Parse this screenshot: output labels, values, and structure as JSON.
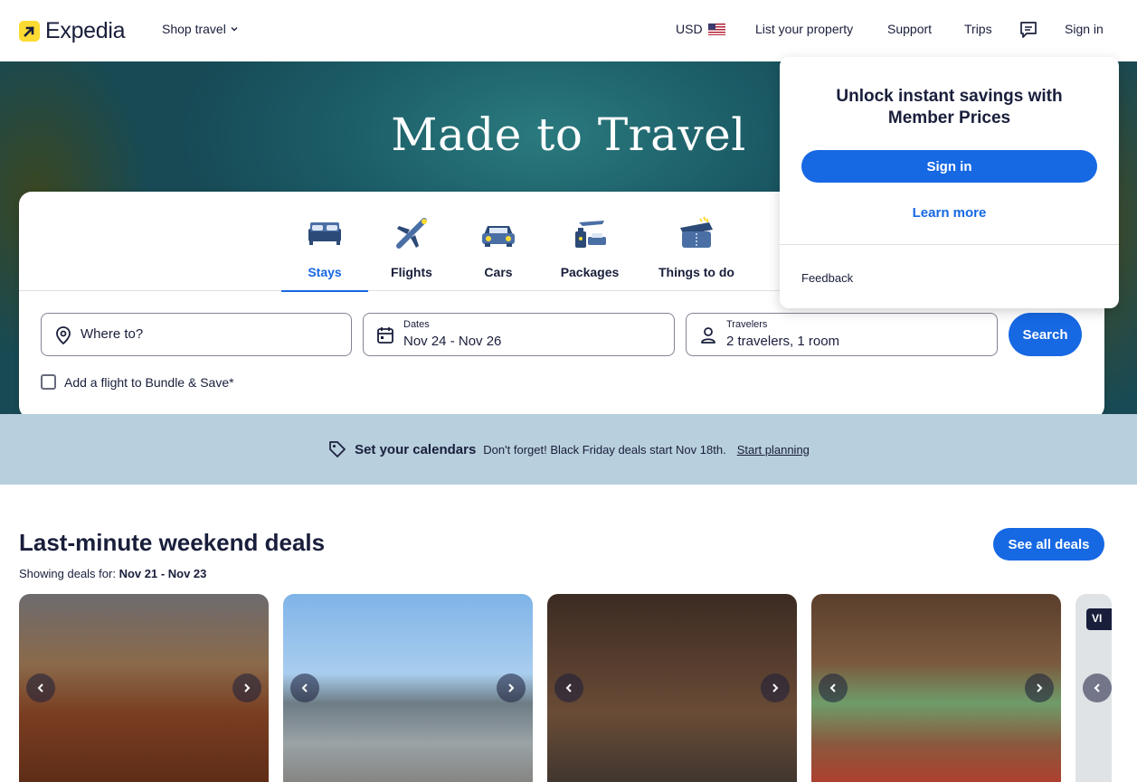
{
  "header": {
    "brand": "Expedia",
    "shop_travel": "Shop travel",
    "currency": "USD",
    "list_property": "List your property",
    "support": "Support",
    "trips": "Trips",
    "sign_in": "Sign in"
  },
  "hero": {
    "title": "Made to Travel"
  },
  "tabs": [
    {
      "label": "Stays",
      "icon": "bed-icon",
      "active": true
    },
    {
      "label": "Flights",
      "icon": "airplane-icon"
    },
    {
      "label": "Cars",
      "icon": "car-icon"
    },
    {
      "label": "Packages",
      "icon": "package-icon"
    },
    {
      "label": "Things to do",
      "icon": "ticket-icon"
    }
  ],
  "search": {
    "where_placeholder": "Where to?",
    "dates_label": "Dates",
    "dates_value": "Nov 24 - Nov 26",
    "travelers_label": "Travelers",
    "travelers_value": "2 travelers, 1 room",
    "button": "Search",
    "bundle_label": "Add a flight to Bundle & Save*"
  },
  "popup": {
    "title": "Unlock instant savings with Member Prices",
    "sign_in": "Sign in",
    "learn_more": "Learn more",
    "feedback": "Feedback"
  },
  "banner": {
    "title": "Set your calendars",
    "text": "Don't forget! Black Friday deals start Nov 18th.",
    "link": "Start planning"
  },
  "deals": {
    "title": "Last-minute weekend deals",
    "showing_label": "Showing deals for:",
    "showing_dates": "Nov 21 - Nov 23",
    "see_all": "See all deals",
    "partial_tag": "VI"
  },
  "colors": {
    "brand_blue": "#1668e3",
    "logo_yellow": "#fddb32",
    "navy": "#191e3b",
    "banner_bg": "#b8cfdd"
  }
}
